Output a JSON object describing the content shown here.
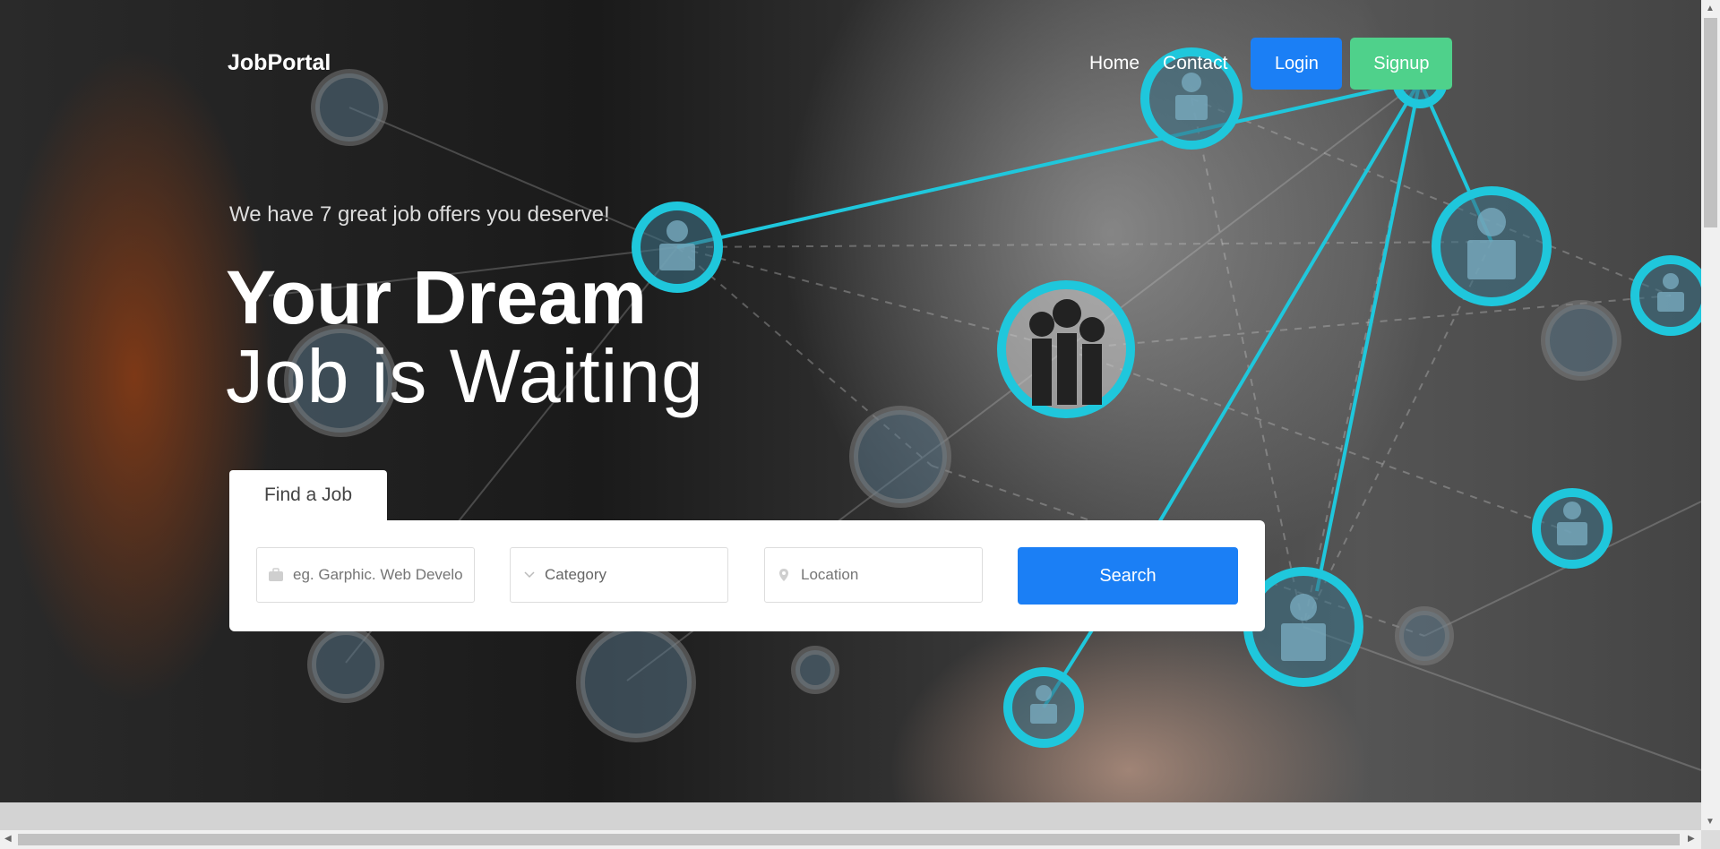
{
  "brand": {
    "name": "JobPortal"
  },
  "nav": {
    "home": "Home",
    "contact": "Contact",
    "login": "Login",
    "signup": "Signup"
  },
  "hero": {
    "tagline": "We have 7 great job offers you deserve!",
    "headline_bold": "Your Dream",
    "headline_light": "Job is Waiting"
  },
  "search": {
    "tab_label": "Find a Job",
    "keyword_placeholder": "eg. Garphic. Web Developer",
    "category_placeholder": "Category",
    "location_placeholder": "Location",
    "button_label": "Search"
  },
  "colors": {
    "primary": "#1b7ff5",
    "signup": "#4fd18b",
    "network_glow": "#1fc7dc"
  }
}
